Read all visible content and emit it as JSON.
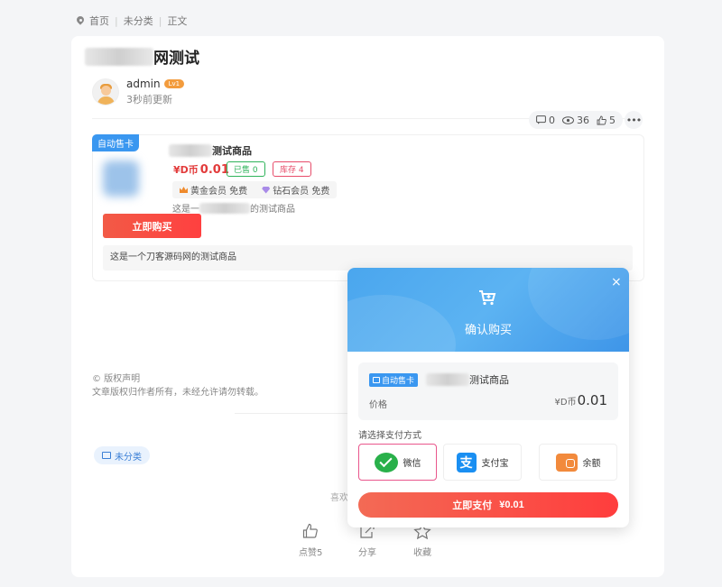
{
  "breadcrumb": {
    "home": "首页",
    "category": "未分类",
    "current": "正文"
  },
  "post": {
    "title_suffix": "网测试",
    "author": "admin",
    "author_level": "Lv1",
    "updated": "3秒前更新",
    "stats": {
      "comments": "0",
      "views": "36",
      "likes": "5"
    }
  },
  "product": {
    "tag": "自动售卡",
    "name_suffix": "测试商品",
    "price_currency": "¥D币",
    "price": "0.01",
    "sold": "已售 0",
    "stock": "库存 4",
    "vip_gold": "黄金会员 免费",
    "vip_diamond": "钻石会员 免费",
    "desc_prefix": "这是一",
    "desc_suffix": "的测试商品",
    "buy_label": "立即购买",
    "detail": "这是一个刀客源码网的测试商品"
  },
  "copyright": {
    "title": "© 版权声明",
    "text": "文章版权归作者所有，未经允许请勿转载。"
  },
  "category_tag": "未分类",
  "hint": "喜欢",
  "actions": {
    "like": "点赞5",
    "share": "分享",
    "favorite": "收藏"
  },
  "modal": {
    "title": "确认购买",
    "close": "×",
    "tag": "自动售卡",
    "name_suffix": "测试商品",
    "price_label": "价格",
    "price_currency": "¥D币",
    "price": "0.01",
    "pay_label": "请选择支付方式",
    "methods": {
      "wechat": "微信",
      "alipay": "支付宝",
      "balance": "余额"
    },
    "pay_button": "立即支付",
    "pay_amount": "¥0.01"
  }
}
